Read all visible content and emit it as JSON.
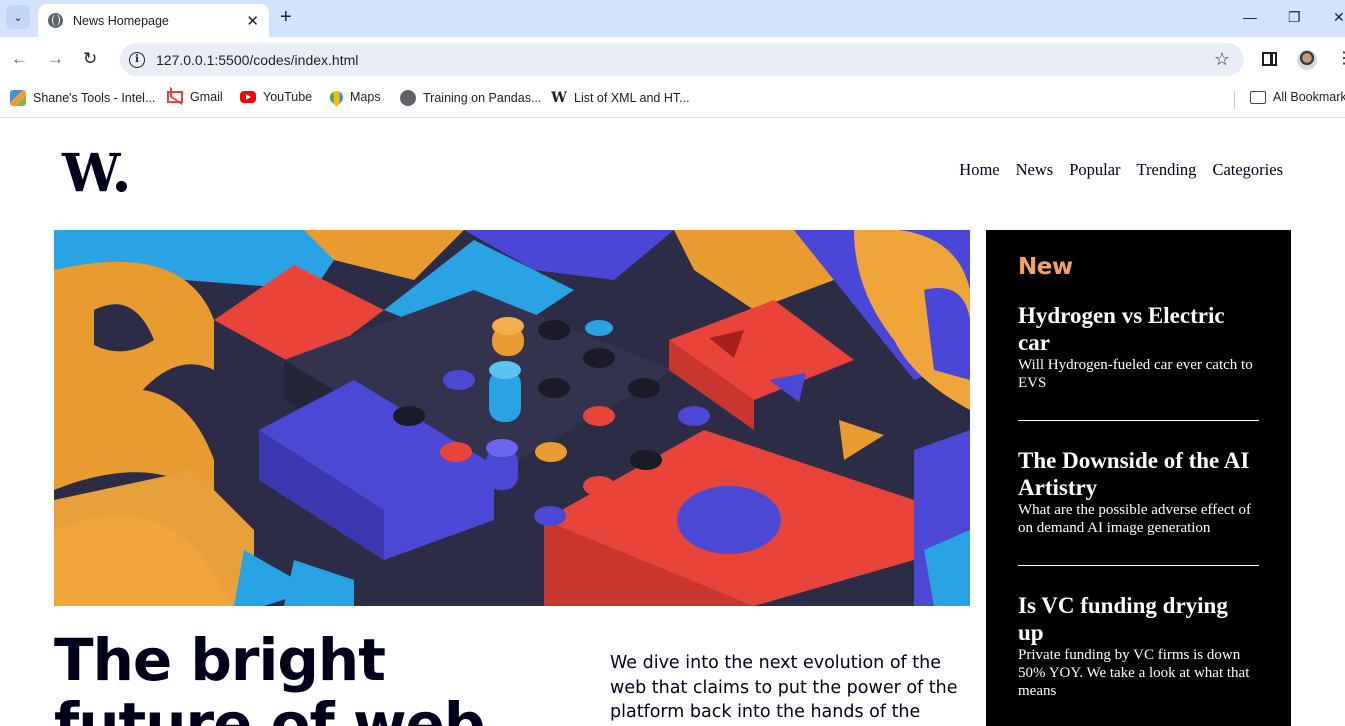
{
  "browser": {
    "tab_title": "News Homepage",
    "url": "127.0.0.1:5500/codes/index.html",
    "bookmarks": [
      {
        "label": "Shane's Tools - Intel...",
        "icon": "tools-icon"
      },
      {
        "label": "Gmail",
        "icon": "gmail-icon"
      },
      {
        "label": "YouTube",
        "icon": "youtube-icon"
      },
      {
        "label": "Maps",
        "icon": "maps-icon"
      },
      {
        "label": "Training on Pandas...",
        "icon": "globe-icon"
      },
      {
        "label": "List of XML and HT...",
        "icon": "wikipedia-icon"
      }
    ],
    "all_bookmarks": "All Bookmarks"
  },
  "site": {
    "logo": "W",
    "nav": [
      "Home",
      "News",
      "Popular",
      "Trending",
      "Categories"
    ]
  },
  "main": {
    "headline_line1": "The bright",
    "headline_line2": "future of web",
    "intro": "We dive into the next evolution of the web that claims to put the power of the platform back into the hands of the people."
  },
  "sidebar": {
    "title": "New",
    "items": [
      {
        "heading": "Hydrogen vs Electric car",
        "text": "Will Hydrogen-fueled car ever catch to EVS"
      },
      {
        "heading": "The Downside of the AI Artistry",
        "text": "What are the possible adverse effect of on demand AI image generation"
      },
      {
        "heading": "Is VC funding drying up",
        "text": "Private funding by VC firms is down 50% YOY. We take a look at what that means"
      }
    ]
  },
  "colors": {
    "accent": "#f4a261",
    "dark": "#00001a",
    "sidebar_bg": "#000000"
  }
}
